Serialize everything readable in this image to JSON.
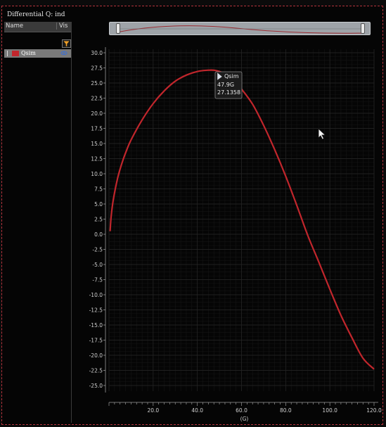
{
  "window": {
    "title": "Differential Q: ind"
  },
  "list": {
    "header_name": "Name",
    "header_vis": "Vis",
    "items": [
      {
        "label": "Qsim",
        "color": "#c1262c",
        "visible_icon": "eye-icon"
      }
    ]
  },
  "tooltip": {
    "series": "Qsim",
    "x": "47.9G",
    "y": "27.1358"
  },
  "chart_data": {
    "type": "line",
    "title": "",
    "xlabel": "(G)",
    "ylabel": "",
    "xlim": [
      0,
      120
    ],
    "ylim": [
      -25,
      30
    ],
    "x_ticks": [
      "20.0",
      "40.0",
      "60.0",
      "80.0",
      "100.0",
      "120.0"
    ],
    "y_ticks": [
      "30.0",
      "27.5",
      "25.0",
      "22.5",
      "20.0",
      "17.5",
      "15.0",
      "12.5",
      "10.0",
      "7.5",
      "5.0",
      "2.5",
      "0.0",
      "-2.5",
      "-5.0",
      "-7.5",
      "-10.0",
      "-12.5",
      "-15.0",
      "-17.5",
      "-20.0",
      "-22.5",
      "-25.0"
    ],
    "grid": true,
    "series": [
      {
        "name": "Qsim",
        "color": "#c1262c",
        "x": [
          0.5,
          1,
          2,
          4,
          6,
          8,
          10,
          15,
          20,
          25,
          30,
          35,
          40,
          44,
          47.9,
          52,
          56,
          60,
          65,
          70,
          75,
          80,
          85,
          90,
          95,
          100,
          105,
          110,
          115,
          120
        ],
        "y": [
          0.5,
          3.0,
          5.8,
          9.4,
          11.9,
          13.9,
          15.6,
          18.9,
          21.6,
          23.7,
          25.3,
          26.3,
          26.9,
          27.1,
          27.1,
          26.6,
          25.6,
          24.0,
          21.5,
          18.0,
          14.0,
          9.6,
          4.8,
          -0.2,
          -4.6,
          -9.1,
          -13.4,
          -17.1,
          -20.5,
          -22.3
        ]
      }
    ]
  }
}
